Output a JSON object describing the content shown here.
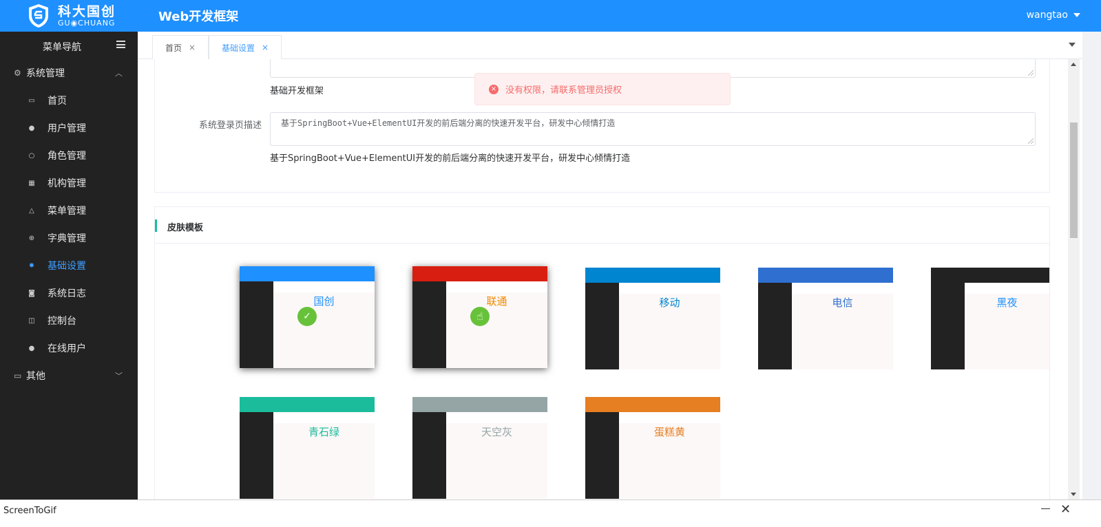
{
  "header": {
    "logo_cn": "科大国创",
    "logo_en": "GU◉CHUANG",
    "app_title": "Web开发框架",
    "username": "wangtao"
  },
  "sidebar": {
    "title": "菜单导航",
    "groups": [
      {
        "label": "系统管理",
        "items": [
          {
            "label": "首页",
            "icon": "folder-icon"
          },
          {
            "label": "用户管理",
            "icon": "user-icon"
          },
          {
            "label": "角色管理",
            "icon": "person-outline-icon"
          },
          {
            "label": "机构管理",
            "icon": "grid-icon"
          },
          {
            "label": "菜单管理",
            "icon": "bag-icon"
          },
          {
            "label": "字典管理",
            "icon": "plus-circle-icon"
          },
          {
            "label": "基础设置",
            "icon": "gear-icon"
          },
          {
            "label": "系统日志",
            "icon": "camera-icon"
          },
          {
            "label": "控制台",
            "icon": "panel-icon"
          },
          {
            "label": "在线用户",
            "icon": "user-icon"
          }
        ]
      },
      {
        "label": "其他",
        "items": []
      }
    ],
    "active_item": "基础设置"
  },
  "tabs": [
    {
      "label": "首页",
      "close": "×"
    },
    {
      "label": "基础设置",
      "close": "×"
    }
  ],
  "form": {
    "system_name_help": "基础开发框架",
    "login_desc_label": "系统登录页描述",
    "login_desc_value": "基于SpringBoot+Vue+ElementUI开发的前后端分离的快速开发平台，研发中心倾情打造",
    "login_desc_help": "基于SpringBoot+Vue+ElementUI开发的前后端分离的快速开发平台，研发中心倾情打造"
  },
  "skins": {
    "title": "皮肤模板",
    "items": [
      {
        "label": "国创",
        "top_color": "#1e90ff",
        "text_color": "#1e90ff",
        "selected": true
      },
      {
        "label": "联通",
        "top_color": "#d81e10",
        "text_color": "#f08a00",
        "selected": false
      },
      {
        "label": "移动",
        "top_color": "#0085d0",
        "text_color": "#0085d0",
        "selected": false
      },
      {
        "label": "电信",
        "top_color": "#2f6fd0",
        "text_color": "#2f6fd0",
        "selected": false
      },
      {
        "label": "黑夜",
        "top_color": "#222222",
        "text_color": "#1e90ff",
        "selected": false
      },
      {
        "label": "青石绿",
        "top_color": "#1abc9c",
        "text_color": "#1abc9c",
        "selected": false
      },
      {
        "label": "天空灰",
        "top_color": "#95a5a6",
        "text_color": "#95a5a6",
        "selected": false
      },
      {
        "label": "蛋糕黄",
        "top_color": "#e67e22",
        "text_color": "#e67e22",
        "selected": false
      }
    ]
  },
  "toast": {
    "message": "没有权限，请联系管理员授权",
    "type": "error"
  },
  "recorder": {
    "name": "ScreenToGif",
    "close": "✕"
  }
}
